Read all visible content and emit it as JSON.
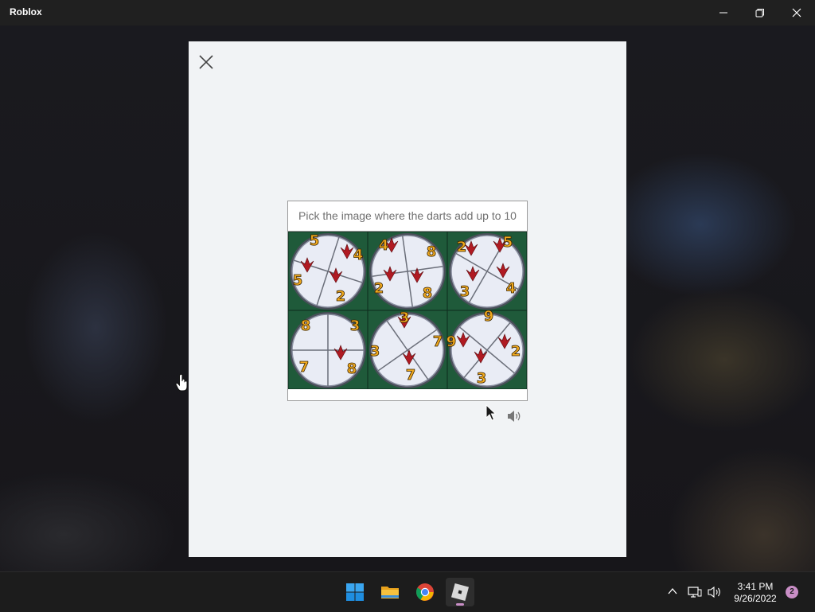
{
  "window": {
    "title": "Roblox"
  },
  "captcha": {
    "prompt": "Pick the image where the darts add up to 10",
    "tiles": [
      {
        "numbers": [
          "5",
          "4",
          "5",
          "2"
        ]
      },
      {
        "numbers": [
          "4",
          "8",
          "2",
          "8"
        ]
      },
      {
        "numbers": [
          "2",
          "5",
          "3",
          "4"
        ]
      },
      {
        "numbers": [
          "8",
          "3",
          "7",
          "8"
        ]
      },
      {
        "numbers": [
          "3",
          "7",
          "3",
          "7"
        ]
      },
      {
        "numbers": [
          "9",
          "2",
          "9",
          "3"
        ]
      }
    ]
  },
  "taskbar": {
    "apps": [
      "windows-start",
      "file-explorer",
      "chrome",
      "roblox"
    ],
    "time": "3:41 PM",
    "date": "9/26/2022",
    "notifications": "2"
  },
  "colors": {
    "accent": "#c98ec6",
    "tile_background": "#1f5a3a",
    "dart": "#b01a22",
    "number": "#f0a91e"
  }
}
